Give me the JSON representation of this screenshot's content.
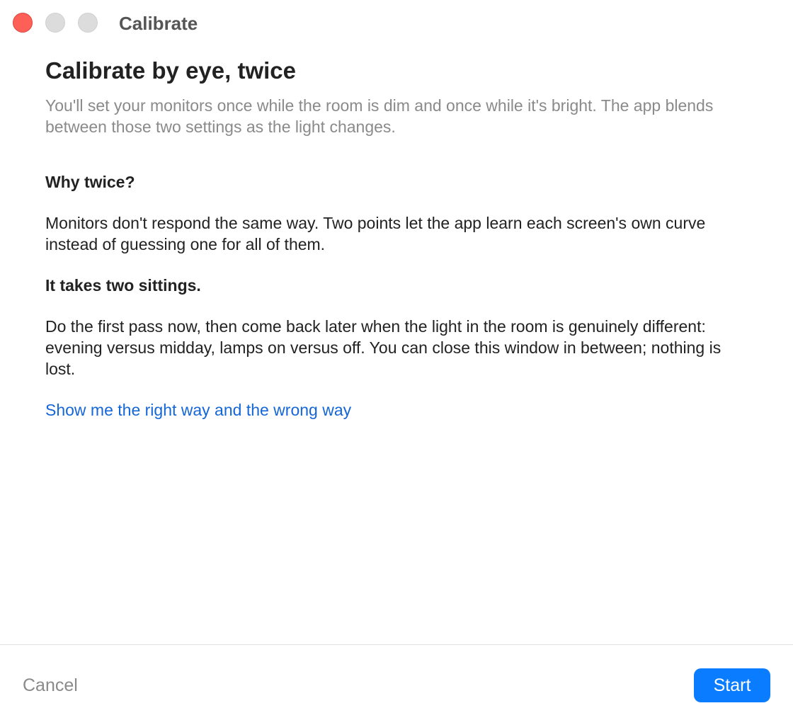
{
  "window": {
    "title": "Calibrate"
  },
  "content": {
    "heading": "Calibrate by eye, twice",
    "subtitle": "You'll set your monitors once while the room is dim and once while it's bright. The app blends between those two settings as the light changes.",
    "sections": [
      {
        "title": "Why twice?",
        "body": "Monitors don't respond the same way. Two points let the app learn each screen's own curve instead of guessing one for all of them."
      },
      {
        "title": "It takes two sittings.",
        "body": "Do the first pass now, then come back later when the light in the room is genuinely different: evening versus midday, lamps on versus off. You can close this window in between; nothing is lost."
      }
    ],
    "link_label": "Show me the right way and the wrong way"
  },
  "footer": {
    "cancel_label": "Cancel",
    "start_label": "Start"
  },
  "colors": {
    "close": "#fe5f57",
    "inactive_traffic": "#dcdcdc",
    "link": "#1566d6",
    "primary_button": "#0a7cff",
    "secondary_text": "#8a8a8a"
  },
  "icons": {
    "close": "close-window-icon",
    "minimize": "minimize-window-icon",
    "zoom": "zoom-window-icon"
  }
}
